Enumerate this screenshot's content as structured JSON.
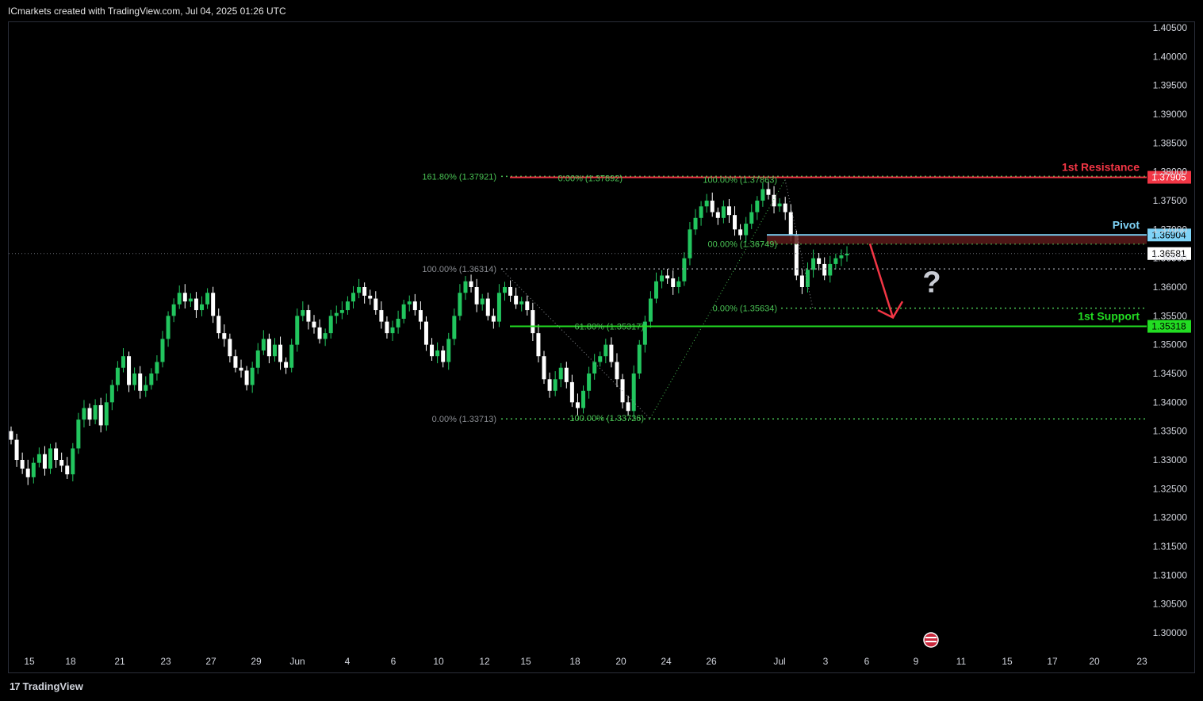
{
  "header": {
    "title": "ICmarkets created with TradingView.com, Jul 04, 2025 01:26 UTC"
  },
  "brand": {
    "name": "TradingView",
    "logo_icon": "tradingview-logo-icon"
  },
  "colors": {
    "up": "#22c55e",
    "down": "#ffffff",
    "resistance": "#f23645",
    "pivot": "#7fd3f7",
    "support": "#22dd22",
    "fib": "#49c254",
    "fib_gray": "#8a8d93",
    "arrow": "#f23645",
    "question": "#c9ccd4"
  },
  "chart_data": {
    "type": "candlestick",
    "symbol_note": "",
    "ylim": [
      1.2945,
      1.4055
    ],
    "y_ticks": [
      "1.40500",
      "1.40000",
      "1.39500",
      "1.39000",
      "1.38500",
      "1.38000",
      "1.37500",
      "1.37000",
      "1.36500",
      "1.36000",
      "1.35500",
      "1.35000",
      "1.34500",
      "1.34000",
      "1.33500",
      "1.33000",
      "1.32500",
      "1.32000",
      "1.31500",
      "1.31000",
      "1.30500",
      "1.30000"
    ],
    "x_ticks": [
      "15",
      "18",
      "21",
      "23",
      "27",
      "29",
      "Jun",
      "4",
      "6",
      "10",
      "12",
      "15",
      "18",
      "20",
      "24",
      "26",
      "Jul",
      "3",
      "6",
      "9",
      "11",
      "15",
      "17",
      "20",
      "23"
    ],
    "current_price": "1.36581",
    "levels": [
      {
        "name": "1st Resistance",
        "value": "1.37905",
        "role": "resistance"
      },
      {
        "name": "Pivot",
        "value": "1.36904",
        "role": "pivot"
      },
      {
        "name": "1st Support",
        "value": "1.35318",
        "role": "support"
      }
    ],
    "fib_labels": [
      {
        "text": "161.80% (1.37921)",
        "value": 1.37921,
        "color": "fib"
      },
      {
        "text": "0.00% (1.37892)",
        "value": 1.37892,
        "color": "fib"
      },
      {
        "text": "100.00% (1.37863)",
        "value": 1.37863,
        "color": "fib"
      },
      {
        "text": "00.00% (1.36749)",
        "value": 1.36749,
        "color": "fib"
      },
      {
        "text": "100.00% (1.36314)",
        "value": 1.36314,
        "color": "fib_gray"
      },
      {
        "text": "0.00% (1.35634)",
        "value": 1.35634,
        "color": "fib"
      },
      {
        "text": "61.80% (1.35317)",
        "value": 1.35317,
        "color": "fib"
      },
      {
        "text": "0.00% (1.33713)",
        "value": 1.33713,
        "color": "fib_gray"
      },
      {
        "text": "100.00% (1.33726)",
        "value": 1.33726,
        "color": "fib"
      }
    ],
    "annotation": "?",
    "forecast": "drop from pivot to 1st support",
    "candles_description": "Daily-style intraday candles from mid-May to early July 2025",
    "closes": [
      1.3335,
      1.33,
      1.3285,
      1.327,
      1.3295,
      1.331,
      1.3285,
      1.332,
      1.33,
      1.329,
      1.3275,
      1.332,
      1.337,
      1.339,
      1.337,
      1.3395,
      1.336,
      1.34,
      1.343,
      1.346,
      1.348,
      1.343,
      1.345,
      1.342,
      1.343,
      1.345,
      1.347,
      1.351,
      1.355,
      1.357,
      1.359,
      1.3575,
      1.358,
      1.356,
      1.357,
      1.359,
      1.355,
      1.352,
      1.351,
      1.348,
      1.346,
      1.3455,
      1.343,
      1.346,
      1.349,
      1.351,
      1.348,
      1.35,
      1.347,
      1.346,
      1.35,
      1.355,
      1.356,
      1.354,
      1.353,
      1.351,
      1.352,
      1.355,
      1.3555,
      1.356,
      1.3575,
      1.359,
      1.36,
      1.3585,
      1.358,
      1.356,
      1.354,
      1.352,
      1.353,
      1.3545,
      1.357,
      1.3575,
      1.356,
      1.354,
      1.35,
      1.348,
      1.349,
      1.347,
      1.351,
      1.355,
      1.359,
      1.361,
      1.36,
      1.357,
      1.358,
      1.355,
      1.354,
      1.359,
      1.36,
      1.3585,
      1.357,
      1.3575,
      1.356,
      1.352,
      1.348,
      1.344,
      1.342,
      1.344,
      1.346,
      1.3435,
      1.34,
      1.339,
      1.342,
      1.345,
      1.347,
      1.348,
      1.35,
      1.347,
      1.344,
      1.34,
      1.3385,
      1.345,
      1.35,
      1.354,
      1.358,
      1.361,
      1.362,
      1.3615,
      1.36,
      1.361,
      1.365,
      1.37,
      1.372,
      1.374,
      1.375,
      1.373,
      1.372,
      1.374,
      1.3725,
      1.37,
      1.369,
      1.371,
      1.373,
      1.375,
      1.377,
      1.376,
      1.374,
      1.3745,
      1.373,
      1.369,
      1.362,
      1.36,
      1.363,
      1.365,
      1.364,
      1.362,
      1.364,
      1.365,
      1.3655,
      1.3658
    ]
  }
}
